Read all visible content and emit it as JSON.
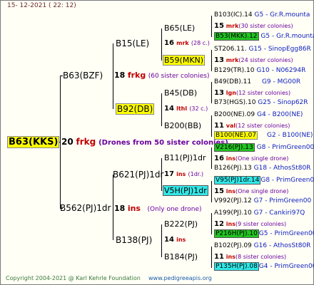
{
  "header": {
    "date": "15- 12-2021 ( 22: 12)"
  },
  "footer": {
    "copyright": "Copyright 2004-2021 @ Karl Kehrle Foundation",
    "site": "www.pedigreeapis.org"
  },
  "root": {
    "label": "B63(KKS)",
    "gen_num": "20",
    "gen_abbr": "frkg",
    "note": "(Drones from 50 sister colonies)"
  },
  "l1_top": {
    "label": "B63(BZF)",
    "gen_num": "18",
    "gen_abbr": "frkg",
    "note": "(60 sister colonies)"
  },
  "l1_bottom": {
    "label": "B562(PJ)1dr",
    "gen_num": "18",
    "gen_abbr": "ins",
    "note": "(Only one drone)"
  },
  "l2": [
    {
      "label": "B15(LE)",
      "gen_num": "16",
      "gen_abbr": "mrk",
      "note": "(28 c.)"
    },
    {
      "label": "B92(DB)",
      "gen_num": "14",
      "gen_abbr": "lthl",
      "note": "(32 c.)"
    },
    {
      "label": "B621(PJ)1dr",
      "gen_num": "17",
      "gen_abbr": "ins",
      "note": "(1dr.)"
    },
    {
      "label": "B138(PJ)",
      "gen_num": "14",
      "gen_abbr": "ins",
      "note": ""
    }
  ],
  "l3": [
    {
      "label": "B65(LE)"
    },
    {
      "label": "B59(MKN)"
    },
    {
      "label": "B45(DB)"
    },
    {
      "label": "B200(BB)"
    },
    {
      "label": "B11(PJ)1dr"
    },
    {
      "label": "V5H(PJ)1dr"
    },
    {
      "label": "B222(PJ)"
    },
    {
      "label": "B184(PJ)"
    }
  ],
  "right": [
    {
      "name": "B103(IC).14",
      "code": "G5 - Gr.R.mounta"
    },
    {
      "num": "15",
      "abbr": "mrk",
      "note": "(30 sister colonies)"
    },
    {
      "name": "B53(MKK).12",
      "code": "G5 - Gr.R.mounta"
    },
    {
      "name": "ST206.11.",
      "code": "G15 - SinopEgg86R"
    },
    {
      "num": "13",
      "abbr": "mrk",
      "note": "(24 sister colonies)"
    },
    {
      "name": "B129(TR).10",
      "code": "G10 - N06294R"
    },
    {
      "name": "B49(DB).11",
      "code": "G9 - MG00R"
    },
    {
      "num": "13",
      "abbr": "lgn",
      "note": "(12 sister colonies)"
    },
    {
      "name": "B73(HGS).10",
      "code": "G25 - Sinop62R"
    },
    {
      "name": "B200(NE).09",
      "code": "G4 - B200(NE)"
    },
    {
      "num": "11",
      "abbr": "val",
      "note": "(12 sister colonies)"
    },
    {
      "name": "B100(NE).07",
      "code": "G2 - B100(NE)"
    },
    {
      "name": "V216(PJ).13",
      "code": "G8 - PrimGreen00"
    },
    {
      "num": "16",
      "abbr": "ins",
      "note": "(One single drone)"
    },
    {
      "name": "B126(PJ).13",
      "code": "G18 - AthosSt80R"
    },
    {
      "name": "V95(PJ)1dr.14",
      "code": "G8 - PrimGreen00"
    },
    {
      "num": "15",
      "abbr": "ins",
      "note": "(One single drone)"
    },
    {
      "name": "V992(PJ).12",
      "code": "G7 - PrimGreen00"
    },
    {
      "name": "A199(PJ).10",
      "code": "G7 - Cankiri97Q"
    },
    {
      "num": "12",
      "abbr": "ins",
      "note": "(9 sister colonies)"
    },
    {
      "name": "P216H(PJ).10",
      "code": "G5 - PrimGreen00"
    },
    {
      "name": "B102(PJ).09",
      "code": "G16 - AthosSt80R"
    },
    {
      "num": "11",
      "abbr": "ins",
      "note": "(8 sister colonies)"
    },
    {
      "name": "P135H(PJ).08",
      "code": "G4 - PrimGreen00"
    }
  ]
}
